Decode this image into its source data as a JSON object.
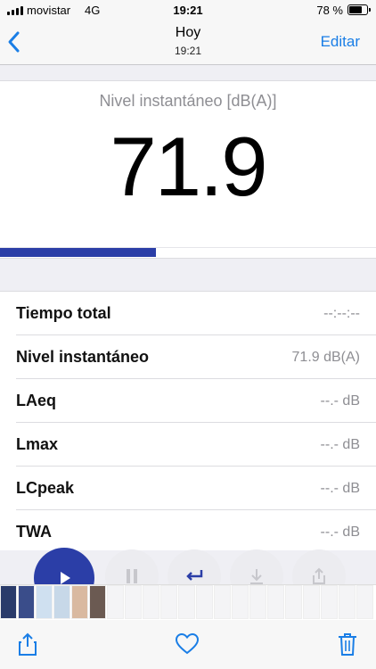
{
  "status_bar": {
    "carrier": "movistar",
    "network": "4G",
    "time": "19:21",
    "battery_percent_label": "78 %",
    "battery_level": 0.78
  },
  "nav": {
    "back_icon": "chevron-left-icon",
    "title": "Hoy",
    "subtitle": "19:21",
    "edit_label": "Editar",
    "accent_color": "#1a7ee6"
  },
  "meter": {
    "label": "Nivel instantáneo [dB(A)]",
    "value": "71.9",
    "level_fraction": 0.415,
    "bar_color": "#2b3ea7"
  },
  "stats": [
    {
      "name": "Tiempo total",
      "value": "--:--:--"
    },
    {
      "name": "Nivel instantáneo",
      "value": "71.9 dB(A)"
    },
    {
      "name": "LAeq",
      "value": "--.- dB"
    },
    {
      "name": "Lmax",
      "value": "--.- dB"
    },
    {
      "name": "LCpeak",
      "value": "--.- dB"
    },
    {
      "name": "TWA",
      "value": "--.- dB"
    }
  ],
  "controls": [
    {
      "id": "play",
      "icon": "play-icon"
    },
    {
      "id": "pause",
      "icon": "pause-icon"
    },
    {
      "id": "reset",
      "icon": "return-arrow-icon"
    },
    {
      "id": "download",
      "icon": "download-icon"
    },
    {
      "id": "share",
      "icon": "share-icon"
    }
  ],
  "toolbar": {
    "share_icon": "share-icon",
    "favorite_icon": "heart-icon",
    "delete_icon": "trash-icon"
  }
}
